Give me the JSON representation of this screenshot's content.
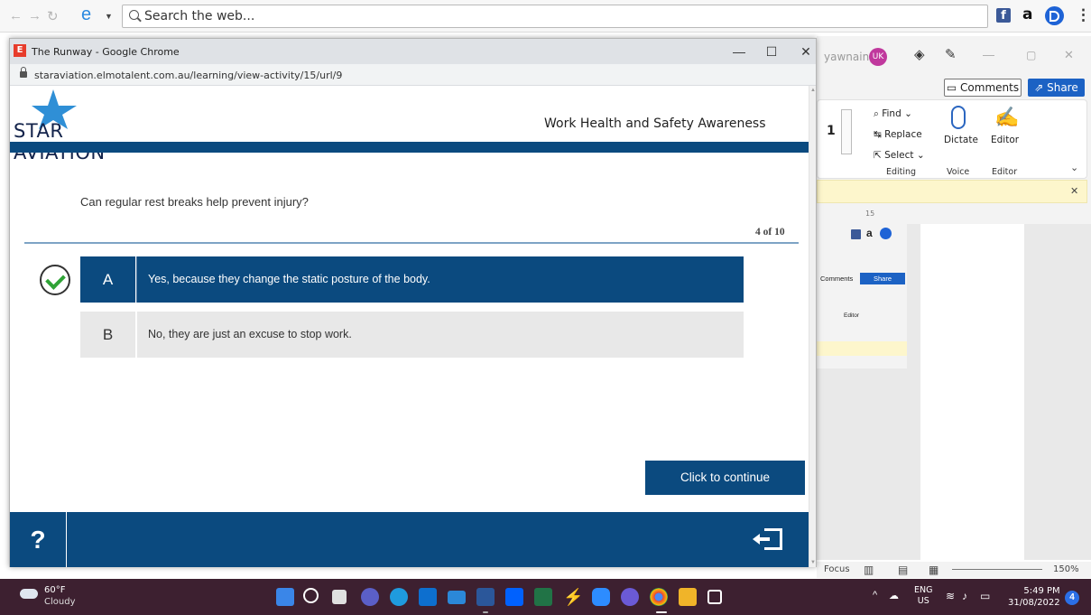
{
  "browser": {
    "search_placeholder": "Search the web...",
    "ext_a": "a",
    "ext_fb": "f",
    "more": "⋮"
  },
  "word": {
    "username": "yawnaing",
    "avatar": "UK",
    "comments": "Comments",
    "share": "Share",
    "font_size": "1",
    "find": "Find",
    "replace": "Replace",
    "select": "Select",
    "dictate": "Dictate",
    "editor": "Editor",
    "group_editing": "Editing",
    "group_voice": "Voice",
    "group_editor": "Editor",
    "ruler_num": "15",
    "focus": "Focus",
    "zoom": "150%",
    "nested_comments": "Comments",
    "nested_share": "Share",
    "nested_editor": "Editor"
  },
  "popup": {
    "favicon": "E",
    "title": "The Runway - Google Chrome",
    "minimize": "—",
    "maximize": "☐",
    "close": "✕",
    "url": "staraviation.elmotalent.com.au/learning/view-activity/15/url/9"
  },
  "course": {
    "logo_text": "STAR AVIATION",
    "title": "Work Health and Safety Awareness",
    "question": "Can regular rest breaks help prevent injury?",
    "counter": "4 of 10",
    "options": [
      {
        "letter": "A",
        "text": "Yes, because they change the static posture of the body."
      },
      {
        "letter": "B",
        "text": "No, they are just an excuse to stop work."
      }
    ],
    "continue": "Click to continue",
    "help": "?"
  },
  "taskbar": {
    "temp": "60°F",
    "condition": "Cloudy",
    "lang": "ENG",
    "region": "US",
    "time": "5:49 PM",
    "date": "31/08/2022",
    "notifications": "4"
  },
  "colors": {
    "brand_blue": "#0b4a7f",
    "correct_green": "#2fa336",
    "taskbar": "#3d2030"
  }
}
